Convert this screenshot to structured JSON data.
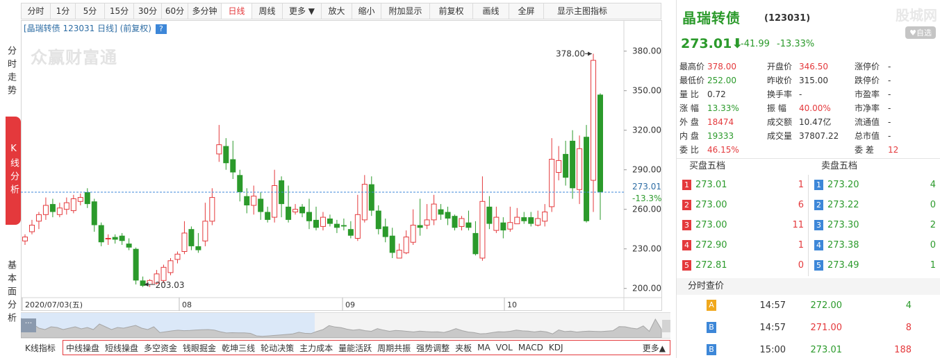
{
  "toolbar": {
    "items": [
      {
        "label": "分时",
        "w": 0
      },
      {
        "label": "1分"
      },
      {
        "label": "5分"
      },
      {
        "label": "15分"
      },
      {
        "label": "30分"
      },
      {
        "label": "60分"
      },
      {
        "label": "多分钟"
      },
      {
        "label": "日线",
        "active": true
      },
      {
        "label": "周线"
      },
      {
        "label": "更多 ▼"
      },
      {
        "label": "放大"
      },
      {
        "label": "缩小"
      },
      {
        "label": "附加显示"
      },
      {
        "label": "前复权"
      },
      {
        "label": "画线"
      },
      {
        "label": "全屏"
      },
      {
        "label": "显示主图指标"
      }
    ]
  },
  "leftnav": [
    {
      "label": "分时走势",
      "active": false
    },
    {
      "label": "K线分析",
      "active": true
    },
    {
      "label": "基本面分析",
      "active": false
    }
  ],
  "chart": {
    "title": "[晶瑞转债 123031 日线] (前复权)",
    "help": "?",
    "watermark": "众赢财富通",
    "max_label": "378.00",
    "min_label": "203.03",
    "current_label": "273.01",
    "current_pct_label": "-13.3%",
    "x_labels": [
      "2020/07/03(五)",
      "08",
      "09",
      "10"
    ]
  },
  "chart_data": {
    "type": "candlestick",
    "title": "[晶瑞转债 123031 日线] (前复权)",
    "ylim": [
      193,
      393
    ],
    "y_ticks": [
      380,
      350,
      320,
      290,
      260,
      230,
      200
    ],
    "x_ticks": [
      "2020/07/03(五)",
      "08",
      "09",
      "10"
    ],
    "last_close": 273.01,
    "candles": [
      [
        236,
        239,
        233,
        241
      ],
      [
        243,
        248,
        241,
        252
      ],
      [
        251,
        256,
        245,
        258
      ],
      [
        256,
        263,
        252,
        269
      ],
      [
        264,
        258,
        254,
        268
      ],
      [
        256,
        261,
        254,
        265
      ],
      [
        260,
        265,
        256,
        269
      ],
      [
        259,
        268,
        257,
        271
      ],
      [
        266,
        269,
        263,
        272
      ],
      [
        273,
        264,
        261,
        276
      ],
      [
        266,
        248,
        243,
        268
      ],
      [
        248,
        235,
        232,
        250
      ],
      [
        238,
        238,
        233,
        241
      ],
      [
        239,
        237,
        234,
        241
      ],
      [
        240,
        236,
        233,
        242
      ],
      [
        234,
        231,
        229,
        238
      ],
      [
        230,
        206,
        203,
        231
      ],
      [
        206,
        202,
        201,
        209
      ],
      [
        203,
        206,
        201,
        207
      ],
      [
        204,
        211,
        203,
        214
      ],
      [
        206,
        216,
        204,
        218
      ],
      [
        212,
        221,
        210,
        223
      ],
      [
        222,
        226,
        219,
        228
      ],
      [
        228,
        242,
        226,
        251
      ],
      [
        245,
        232,
        229,
        247
      ],
      [
        232,
        229,
        227,
        242
      ],
      [
        236,
        251,
        232,
        265
      ],
      [
        251,
        269,
        248,
        276
      ],
      [
        302,
        309,
        296,
        324
      ],
      [
        308,
        295,
        290,
        314
      ],
      [
        298,
        288,
        283,
        312
      ],
      [
        286,
        273,
        266,
        290
      ],
      [
        270,
        263,
        257,
        276
      ],
      [
        263,
        270,
        256,
        278
      ],
      [
        268,
        258,
        252,
        273
      ],
      [
        258,
        252,
        250,
        262
      ],
      [
        254,
        278,
        250,
        290
      ],
      [
        282,
        264,
        254,
        285
      ],
      [
        262,
        252,
        250,
        278
      ],
      [
        258,
        260,
        256,
        264
      ],
      [
        262,
        257,
        254,
        264
      ],
      [
        258,
        251,
        245,
        268
      ],
      [
        252,
        246,
        244,
        262
      ],
      [
        247,
        254,
        244,
        258
      ],
      [
        253,
        249,
        247,
        256
      ],
      [
        249,
        246,
        242,
        252
      ],
      [
        248,
        247,
        244,
        253
      ],
      [
        245,
        240,
        238,
        251
      ],
      [
        238,
        256,
        236,
        271
      ],
      [
        252,
        279,
        250,
        286
      ],
      [
        279,
        259,
        255,
        285
      ],
      [
        259,
        245,
        241,
        263
      ],
      [
        247,
        239,
        235,
        253
      ],
      [
        240,
        227,
        223,
        246
      ],
      [
        223,
        229,
        225,
        234
      ],
      [
        227,
        239,
        226,
        244
      ],
      [
        235,
        248,
        233,
        260
      ],
      [
        248,
        246,
        240,
        268
      ],
      [
        248,
        252,
        245,
        264
      ],
      [
        252,
        264,
        248,
        271
      ],
      [
        260,
        256,
        252,
        264
      ],
      [
        258,
        253,
        248,
        262
      ],
      [
        255,
        246,
        244,
        256
      ],
      [
        247,
        253,
        244,
        255
      ],
      [
        250,
        246,
        244,
        259
      ],
      [
        242,
        226,
        225,
        251
      ],
      [
        223,
        266,
        221,
        285
      ],
      [
        262,
        249,
        245,
        270
      ],
      [
        244,
        254,
        242,
        262
      ],
      [
        250,
        244,
        238,
        254
      ],
      [
        245,
        250,
        243,
        262
      ],
      [
        249,
        254,
        250,
        261
      ],
      [
        254,
        251,
        249,
        258
      ],
      [
        254,
        249,
        247,
        258
      ],
      [
        248,
        253,
        247,
        259
      ],
      [
        251,
        258,
        247,
        264
      ],
      [
        262,
        298,
        258,
        314
      ],
      [
        288,
        297,
        282,
        308
      ],
      [
        302,
        284,
        278,
        312
      ],
      [
        312,
        276,
        268,
        320
      ],
      [
        275,
        306,
        264,
        316
      ],
      [
        315,
        251,
        250,
        324
      ],
      [
        282,
        373,
        258,
        378
      ],
      [
        347,
        273,
        252,
        348
      ]
    ]
  },
  "navigator": {
    "handle": "···"
  },
  "indicators": {
    "label": "K线指标",
    "items": [
      "中线操盘",
      "短线操盘",
      "多空资金",
      "钱眼掘金",
      "乾坤三线",
      "轮动决策",
      "主力成本",
      "量能活跃",
      "周期共振",
      "强势调整",
      "夹板",
      "MA",
      "VOL",
      "MACD",
      "KDJ"
    ],
    "more": "更多▲"
  },
  "stock": {
    "name": "晶瑞转债",
    "code": "(123031)",
    "logo": "股城网",
    "watch": "♥自选",
    "price": "273.01⬇",
    "change": "-41.99",
    "change_pct": "-13.33%"
  },
  "quote": [
    [
      {
        "l": "最高价",
        "v": "378.00",
        "c": "red"
      },
      {
        "l": "开盘价",
        "v": "346.50",
        "c": "red"
      },
      {
        "l": "涨停价",
        "v": "-",
        "c": "dark"
      }
    ],
    [
      {
        "l": "最低价",
        "v": "252.00",
        "c": "green"
      },
      {
        "l": "昨收价",
        "v": "315.00",
        "c": "dark"
      },
      {
        "l": "跌停价",
        "v": "-",
        "c": "dark"
      }
    ],
    [
      {
        "l": "量 比",
        "v": "0.72",
        "c": "dark"
      },
      {
        "l": "换手率",
        "v": "-",
        "c": "dark"
      },
      {
        "l": "市盈率",
        "v": "-",
        "c": "dark"
      }
    ],
    [
      {
        "l": "涨 幅",
        "v": "13.33%",
        "c": "green"
      },
      {
        "l": "振 幅",
        "v": "40.00%",
        "c": "red"
      },
      {
        "l": "市净率",
        "v": "-",
        "c": "dark"
      }
    ],
    [
      {
        "l": "外 盘",
        "v": "18474",
        "c": "red"
      },
      {
        "l": "成交额",
        "v": "10.47亿",
        "c": "dark"
      },
      {
        "l": "流通值",
        "v": "-",
        "c": "dark"
      }
    ],
    [
      {
        "l": "内 盘",
        "v": "19333",
        "c": "green"
      },
      {
        "l": "成交量",
        "v": "37807.22",
        "c": "dark"
      },
      {
        "l": "总市值",
        "v": "-",
        "c": "dark"
      }
    ],
    [
      {
        "l": "委 比",
        "v": "46.15%",
        "c": "red"
      },
      {
        "l": "",
        "v": "",
        "c": "dark"
      },
      {
        "l": "委 差",
        "v": "12",
        "c": "red"
      }
    ]
  ],
  "book": {
    "buy_head": "买盘五档",
    "sell_head": "卖盘五档",
    "buy": [
      {
        "n": "1",
        "p": "273.01",
        "v": "1"
      },
      {
        "n": "2",
        "p": "273.00",
        "v": "6"
      },
      {
        "n": "3",
        "p": "273.00",
        "v": "11"
      },
      {
        "n": "4",
        "p": "272.90",
        "v": "1"
      },
      {
        "n": "5",
        "p": "272.81",
        "v": "0"
      }
    ],
    "sell": [
      {
        "n": "1",
        "p": "273.20",
        "v": "4"
      },
      {
        "n": "2",
        "p": "273.22",
        "v": "0"
      },
      {
        "n": "3",
        "p": "273.30",
        "v": "2"
      },
      {
        "n": "4",
        "p": "273.38",
        "v": "0"
      },
      {
        "n": "5",
        "p": "273.49",
        "v": "1"
      }
    ]
  },
  "ticks": {
    "head": "分时查价",
    "rows": [
      {
        "t": "A",
        "time": "14:57",
        "price": "272.00",
        "vol": "4",
        "pc": "green",
        "vc": "green"
      },
      {
        "t": "B",
        "time": "14:57",
        "price": "271.00",
        "vol": "8",
        "pc": "red",
        "vc": "red"
      },
      {
        "t": "B",
        "time": "15:00",
        "price": "273.01",
        "vol": "188",
        "pc": "green",
        "vc": "red"
      }
    ]
  }
}
